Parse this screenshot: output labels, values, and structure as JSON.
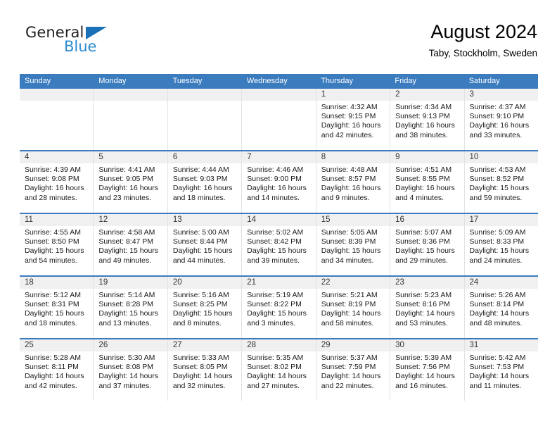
{
  "brand": {
    "name_part1": "General",
    "name_part2": "Blue",
    "accent_color": "#2e8bd0",
    "triangle_color": "#1a71b8"
  },
  "header": {
    "title": "August 2024",
    "location": "Taby, Stockholm, Sweden"
  },
  "calendar": {
    "header_color": "#3b7cbf",
    "weekdays": [
      "Sunday",
      "Monday",
      "Tuesday",
      "Wednesday",
      "Thursday",
      "Friday",
      "Saturday"
    ],
    "weeks": [
      [
        {
          "day": "",
          "sunrise": "",
          "sunset": "",
          "daylight": "",
          "daylight2": ""
        },
        {
          "day": "",
          "sunrise": "",
          "sunset": "",
          "daylight": "",
          "daylight2": ""
        },
        {
          "day": "",
          "sunrise": "",
          "sunset": "",
          "daylight": "",
          "daylight2": ""
        },
        {
          "day": "",
          "sunrise": "",
          "sunset": "",
          "daylight": "",
          "daylight2": ""
        },
        {
          "day": "1",
          "sunrise": "Sunrise: 4:32 AM",
          "sunset": "Sunset: 9:15 PM",
          "daylight": "Daylight: 16 hours",
          "daylight2": "and 42 minutes."
        },
        {
          "day": "2",
          "sunrise": "Sunrise: 4:34 AM",
          "sunset": "Sunset: 9:13 PM",
          "daylight": "Daylight: 16 hours",
          "daylight2": "and 38 minutes."
        },
        {
          "day": "3",
          "sunrise": "Sunrise: 4:37 AM",
          "sunset": "Sunset: 9:10 PM",
          "daylight": "Daylight: 16 hours",
          "daylight2": "and 33 minutes."
        }
      ],
      [
        {
          "day": "4",
          "sunrise": "Sunrise: 4:39 AM",
          "sunset": "Sunset: 9:08 PM",
          "daylight": "Daylight: 16 hours",
          "daylight2": "and 28 minutes."
        },
        {
          "day": "5",
          "sunrise": "Sunrise: 4:41 AM",
          "sunset": "Sunset: 9:05 PM",
          "daylight": "Daylight: 16 hours",
          "daylight2": "and 23 minutes."
        },
        {
          "day": "6",
          "sunrise": "Sunrise: 4:44 AM",
          "sunset": "Sunset: 9:03 PM",
          "daylight": "Daylight: 16 hours",
          "daylight2": "and 18 minutes."
        },
        {
          "day": "7",
          "sunrise": "Sunrise: 4:46 AM",
          "sunset": "Sunset: 9:00 PM",
          "daylight": "Daylight: 16 hours",
          "daylight2": "and 14 minutes."
        },
        {
          "day": "8",
          "sunrise": "Sunrise: 4:48 AM",
          "sunset": "Sunset: 8:57 PM",
          "daylight": "Daylight: 16 hours",
          "daylight2": "and 9 minutes."
        },
        {
          "day": "9",
          "sunrise": "Sunrise: 4:51 AM",
          "sunset": "Sunset: 8:55 PM",
          "daylight": "Daylight: 16 hours",
          "daylight2": "and 4 minutes."
        },
        {
          "day": "10",
          "sunrise": "Sunrise: 4:53 AM",
          "sunset": "Sunset: 8:52 PM",
          "daylight": "Daylight: 15 hours",
          "daylight2": "and 59 minutes."
        }
      ],
      [
        {
          "day": "11",
          "sunrise": "Sunrise: 4:55 AM",
          "sunset": "Sunset: 8:50 PM",
          "daylight": "Daylight: 15 hours",
          "daylight2": "and 54 minutes."
        },
        {
          "day": "12",
          "sunrise": "Sunrise: 4:58 AM",
          "sunset": "Sunset: 8:47 PM",
          "daylight": "Daylight: 15 hours",
          "daylight2": "and 49 minutes."
        },
        {
          "day": "13",
          "sunrise": "Sunrise: 5:00 AM",
          "sunset": "Sunset: 8:44 PM",
          "daylight": "Daylight: 15 hours",
          "daylight2": "and 44 minutes."
        },
        {
          "day": "14",
          "sunrise": "Sunrise: 5:02 AM",
          "sunset": "Sunset: 8:42 PM",
          "daylight": "Daylight: 15 hours",
          "daylight2": "and 39 minutes."
        },
        {
          "day": "15",
          "sunrise": "Sunrise: 5:05 AM",
          "sunset": "Sunset: 8:39 PM",
          "daylight": "Daylight: 15 hours",
          "daylight2": "and 34 minutes."
        },
        {
          "day": "16",
          "sunrise": "Sunrise: 5:07 AM",
          "sunset": "Sunset: 8:36 PM",
          "daylight": "Daylight: 15 hours",
          "daylight2": "and 29 minutes."
        },
        {
          "day": "17",
          "sunrise": "Sunrise: 5:09 AM",
          "sunset": "Sunset: 8:33 PM",
          "daylight": "Daylight: 15 hours",
          "daylight2": "and 24 minutes."
        }
      ],
      [
        {
          "day": "18",
          "sunrise": "Sunrise: 5:12 AM",
          "sunset": "Sunset: 8:31 PM",
          "daylight": "Daylight: 15 hours",
          "daylight2": "and 18 minutes."
        },
        {
          "day": "19",
          "sunrise": "Sunrise: 5:14 AM",
          "sunset": "Sunset: 8:28 PM",
          "daylight": "Daylight: 15 hours",
          "daylight2": "and 13 minutes."
        },
        {
          "day": "20",
          "sunrise": "Sunrise: 5:16 AM",
          "sunset": "Sunset: 8:25 PM",
          "daylight": "Daylight: 15 hours",
          "daylight2": "and 8 minutes."
        },
        {
          "day": "21",
          "sunrise": "Sunrise: 5:19 AM",
          "sunset": "Sunset: 8:22 PM",
          "daylight": "Daylight: 15 hours",
          "daylight2": "and 3 minutes."
        },
        {
          "day": "22",
          "sunrise": "Sunrise: 5:21 AM",
          "sunset": "Sunset: 8:19 PM",
          "daylight": "Daylight: 14 hours",
          "daylight2": "and 58 minutes."
        },
        {
          "day": "23",
          "sunrise": "Sunrise: 5:23 AM",
          "sunset": "Sunset: 8:16 PM",
          "daylight": "Daylight: 14 hours",
          "daylight2": "and 53 minutes."
        },
        {
          "day": "24",
          "sunrise": "Sunrise: 5:26 AM",
          "sunset": "Sunset: 8:14 PM",
          "daylight": "Daylight: 14 hours",
          "daylight2": "and 48 minutes."
        }
      ],
      [
        {
          "day": "25",
          "sunrise": "Sunrise: 5:28 AM",
          "sunset": "Sunset: 8:11 PM",
          "daylight": "Daylight: 14 hours",
          "daylight2": "and 42 minutes."
        },
        {
          "day": "26",
          "sunrise": "Sunrise: 5:30 AM",
          "sunset": "Sunset: 8:08 PM",
          "daylight": "Daylight: 14 hours",
          "daylight2": "and 37 minutes."
        },
        {
          "day": "27",
          "sunrise": "Sunrise: 5:33 AM",
          "sunset": "Sunset: 8:05 PM",
          "daylight": "Daylight: 14 hours",
          "daylight2": "and 32 minutes."
        },
        {
          "day": "28",
          "sunrise": "Sunrise: 5:35 AM",
          "sunset": "Sunset: 8:02 PM",
          "daylight": "Daylight: 14 hours",
          "daylight2": "and 27 minutes."
        },
        {
          "day": "29",
          "sunrise": "Sunrise: 5:37 AM",
          "sunset": "Sunset: 7:59 PM",
          "daylight": "Daylight: 14 hours",
          "daylight2": "and 22 minutes."
        },
        {
          "day": "30",
          "sunrise": "Sunrise: 5:39 AM",
          "sunset": "Sunset: 7:56 PM",
          "daylight": "Daylight: 14 hours",
          "daylight2": "and 16 minutes."
        },
        {
          "day": "31",
          "sunrise": "Sunrise: 5:42 AM",
          "sunset": "Sunset: 7:53 PM",
          "daylight": "Daylight: 14 hours",
          "daylight2": "and 11 minutes."
        }
      ]
    ]
  }
}
